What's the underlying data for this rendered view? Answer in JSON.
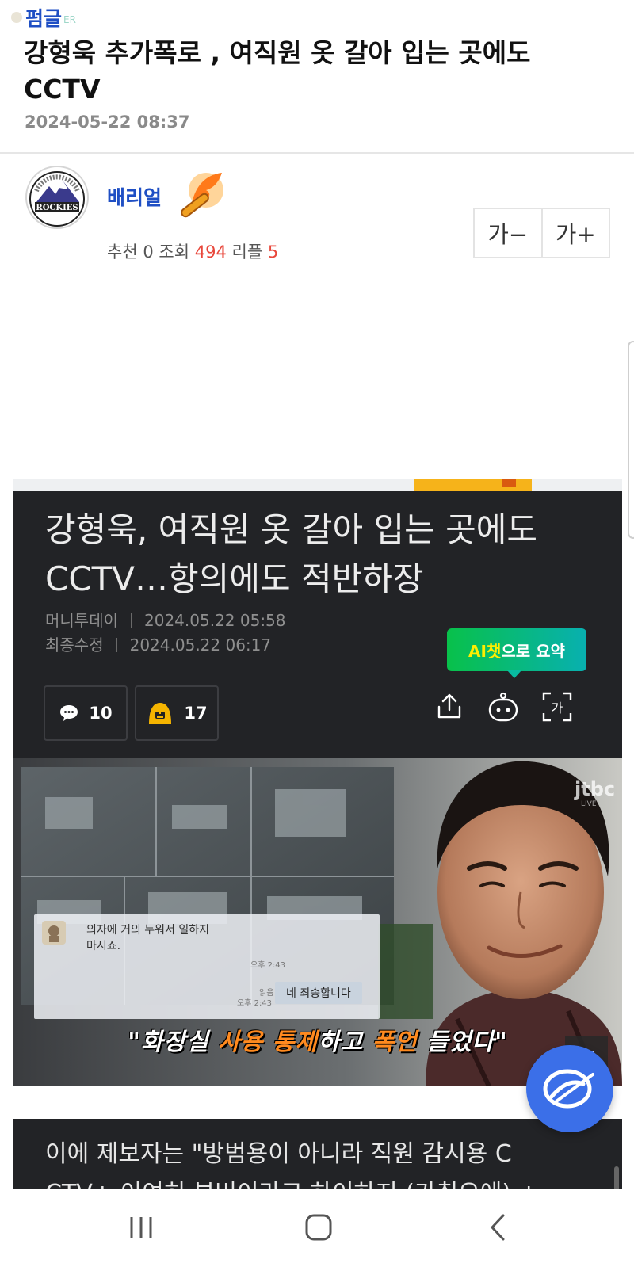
{
  "board": {
    "label": "펌글",
    "faint_suffix": "ER"
  },
  "post": {
    "title": "강형욱 추가폭로 , 여직원 옷 갈아 입는 곳에도 CCTV",
    "date": "2024-05-22 08:37"
  },
  "author": {
    "avatar_icon": "rockies-logo-icon",
    "name": "배리얼",
    "badge_icon": "flame-bat-badge-icon"
  },
  "stats": {
    "recommend_label": "추천",
    "recommend_count": "0",
    "views_label": "조회",
    "views_count": "494",
    "replies_label": "리플",
    "replies_count": "5"
  },
  "font_controls": {
    "decrease": "가−",
    "increase": "가+"
  },
  "article": {
    "title": "강형욱, 여직원 옷 갈아 입는 곳에도 CCTV…항의에도 적반하장",
    "source": "머니투데이",
    "published": "2024.05.22 05:58",
    "modified_label": "최종수정",
    "modified": "2024.05.22 06:17",
    "ai_chip": {
      "highlight": "AI챗",
      "rest": "으로 요약"
    },
    "comment_count": "10",
    "reaction_count": "17",
    "tools": [
      "share-icon",
      "ai-bot-icon",
      "text-size-icon"
    ]
  },
  "photo": {
    "caption_pre": "\"화장실 ",
    "caption_hot1": "사용 통제",
    "caption_mid": "하고 ",
    "caption_hot2": "폭언",
    "caption_post": " 들었다\"",
    "chat_message_line1": "의자에 거의 누워서 일하지",
    "chat_message_line2": "마시죠.",
    "chat_time1": "오후 2:43",
    "chat_read": "읽음",
    "chat_time2": "오후 2:43",
    "chat_reply": "네 죄송합니다",
    "broadcaster": "jtbc",
    "broadcaster_sub": "LIVE",
    "expand_icon": "expand-icon"
  },
  "article_body": {
    "line1": "이에 제보자는 \"방범용이 아니라 직원 감시용 C",
    "line2": "CTV+ 이여히 부버이라고 하이하지 (가취오에) +"
  },
  "fab_icon": "chat-bubble-icon",
  "navbar": {
    "icons": [
      "recent-apps-icon",
      "home-icon",
      "back-icon"
    ]
  },
  "colors": {
    "accent_blue": "#1f4fc4",
    "count_red": "#e8473b",
    "ai_green": "#08c14a",
    "fab_blue": "#3b6fe8"
  }
}
